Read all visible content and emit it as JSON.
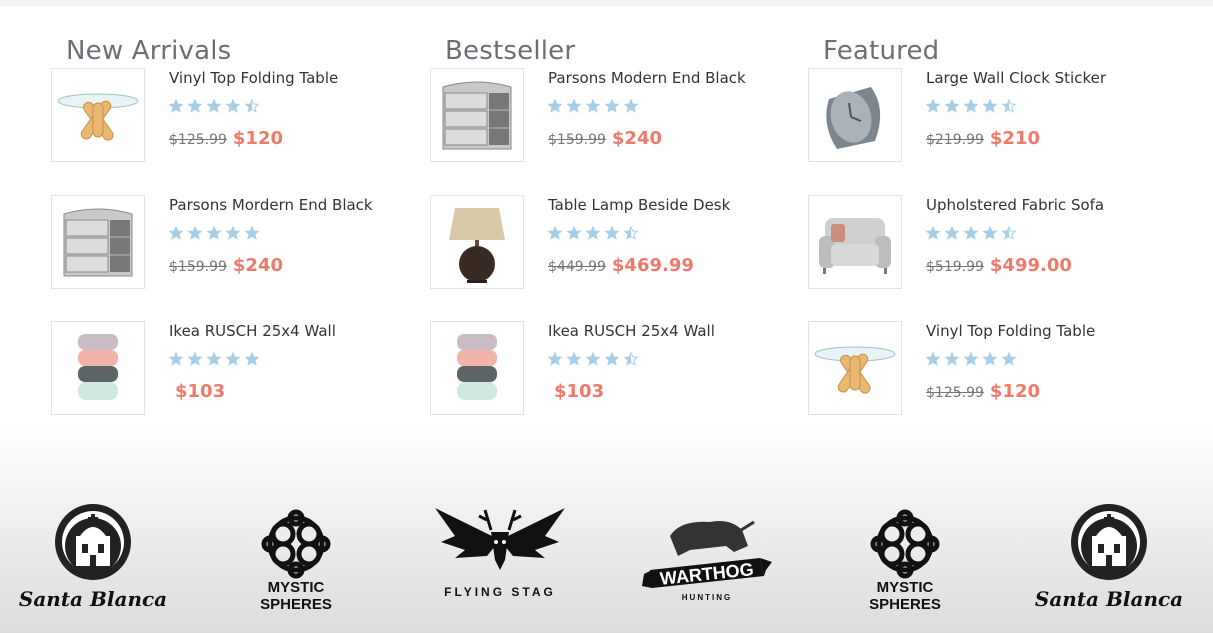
{
  "columns": [
    {
      "title": "New Arrivals",
      "items": [
        {
          "name": "Vinyl Top Folding Table",
          "rating": 4.5,
          "old_price": "$125.99",
          "price": "$120",
          "image": "glass-table-icon"
        },
        {
          "name": "Parsons Mordern End Black",
          "rating": 5,
          "old_price": "$159.99",
          "price": "$240",
          "image": "dresser-icon"
        },
        {
          "name": "Ikea RUSCH 25x4 Wall",
          "rating": 5,
          "old_price": "",
          "price": "$103",
          "image": "stacked-containers-icon"
        }
      ]
    },
    {
      "title": "Bestseller",
      "items": [
        {
          "name": "Parsons Modern End Black",
          "rating": 5,
          "old_price": "$159.99",
          "price": "$240",
          "image": "dresser-icon"
        },
        {
          "name": "Table Lamp Beside Desk",
          "rating": 4.5,
          "old_price": "$449.99",
          "price": "$469.99",
          "image": "table-lamp-icon"
        },
        {
          "name": "Ikea RUSCH 25x4 Wall",
          "rating": 4.5,
          "old_price": "",
          "price": "$103",
          "image": "stacked-containers-icon"
        }
      ]
    },
    {
      "title": "Featured",
      "items": [
        {
          "name": "Large Wall Clock Sticker",
          "rating": 4.5,
          "old_price": "$219.99",
          "price": "$210",
          "image": "clock-icon"
        },
        {
          "name": "Upholstered Fabric Sofa",
          "rating": 4.5,
          "old_price": "$519.99",
          "price": "$499.00",
          "image": "sofa-icon"
        },
        {
          "name": "Vinyl Top Folding Table",
          "rating": 5,
          "old_price": "$125.99",
          "price": "$120",
          "image": "glass-table-icon"
        }
      ]
    }
  ],
  "brands": [
    {
      "name": "Santa Blanca",
      "text": "Santa Blanca",
      "icon": "santa-blanca-logo"
    },
    {
      "name": "Mystic Spheres",
      "text_line1": "MYSTIC",
      "text_line2": "SPHERES",
      "icon": "mystic-spheres-logo"
    },
    {
      "name": "Flying Stag",
      "text": "FLYING STAG",
      "icon": "flying-stag-logo"
    },
    {
      "name": "Warthog Hunting",
      "text": "WARTHOG",
      "sub": "HUNTING",
      "icon": "warthog-logo"
    },
    {
      "name": "Mystic Spheres",
      "text_line1": "MYSTIC",
      "text_line2": "SPHERES",
      "icon": "mystic-spheres-logo"
    },
    {
      "name": "Santa Blanca",
      "text": "Santa Blanca",
      "icon": "santa-blanca-logo"
    }
  ],
  "colors": {
    "star": "#a9cfe6",
    "price": "#f07a6a",
    "title": "#6b6f76"
  }
}
